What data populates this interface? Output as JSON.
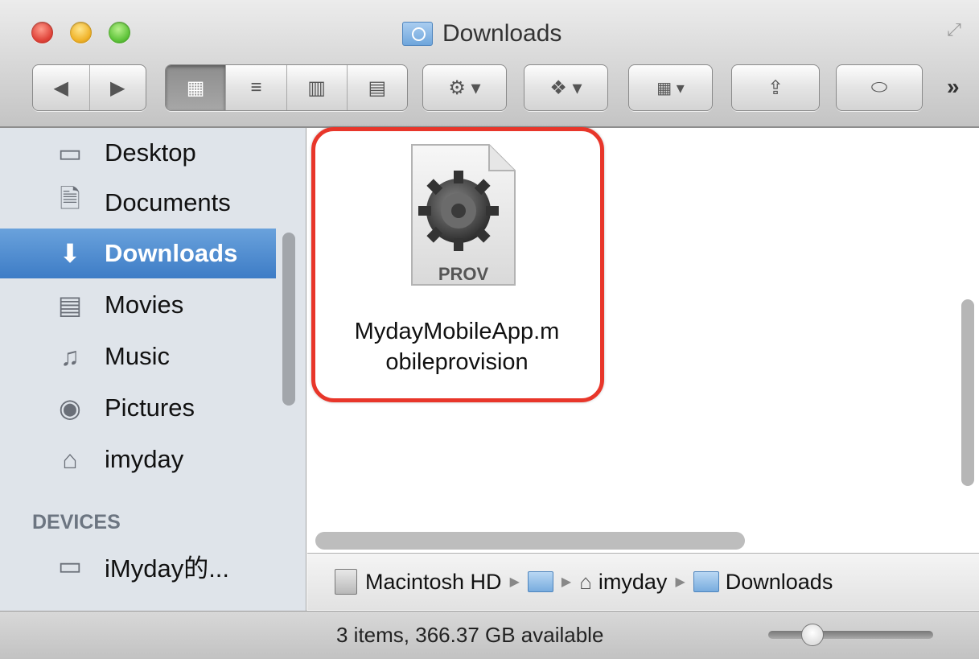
{
  "window": {
    "title": "Downloads"
  },
  "toolbar": {
    "back_glyph": "◀",
    "forward_glyph": "▶",
    "view_icon_glyph": "▦",
    "view_list_glyph": "≡",
    "view_columns_glyph": "▥",
    "view_coverflow_glyph": "▤",
    "action_glyph": "⚙ ▾",
    "dropbox_glyph": "❖ ▾",
    "arrange_glyph": "▦ ▾",
    "share_glyph": "⇪",
    "tags_glyph": "⬭",
    "overflow_glyph": "»"
  },
  "sidebar": {
    "items": [
      {
        "label": "Desktop",
        "icon": "desktop-icon",
        "glyph": "▭"
      },
      {
        "label": "Documents",
        "icon": "documents-icon",
        "glyph": "🗎"
      },
      {
        "label": "Downloads",
        "icon": "downloads-icon",
        "glyph": "⬇",
        "selected": true
      },
      {
        "label": "Movies",
        "icon": "movies-icon",
        "glyph": "▤"
      },
      {
        "label": "Music",
        "icon": "music-icon",
        "glyph": "♫"
      },
      {
        "label": "Pictures",
        "icon": "pictures-icon",
        "glyph": "◉"
      },
      {
        "label": "imyday",
        "icon": "home-icon",
        "glyph": "⌂"
      }
    ],
    "devices_header": "DEVICES",
    "devices": [
      {
        "label": "iMyday的...",
        "icon": "laptop-icon",
        "glyph": "▭"
      }
    ]
  },
  "content": {
    "file": {
      "badge": "PROV",
      "name_line1": "MydayMobileApp.m",
      "name_line2": "obileprovision"
    }
  },
  "pathbar": {
    "items": [
      "Macintosh HD",
      "",
      "imyday",
      "Downloads"
    ]
  },
  "status": {
    "text": "3 items, 366.37 GB available"
  },
  "colors": {
    "highlight": "#e8362a",
    "selection": "#3d7cc6"
  }
}
